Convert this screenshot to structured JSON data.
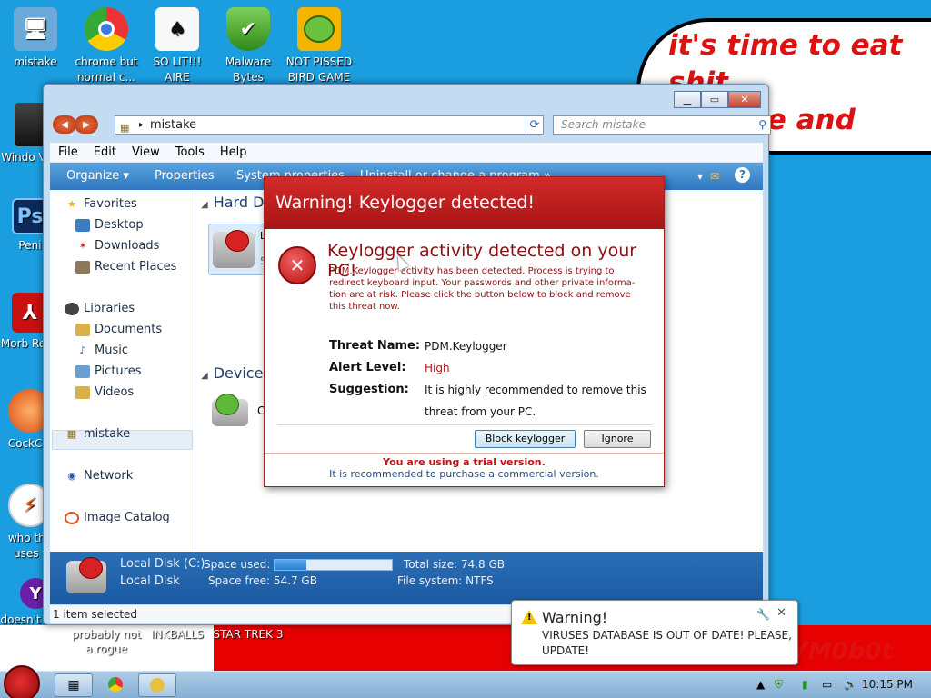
{
  "desktop": {
    "icons": [
      {
        "label": "mistake",
        "icon": "computer-icon"
      },
      {
        "label": "chrome but normal c...",
        "icon": "chrome-icon"
      },
      {
        "label": "SO LIT!!! AIRE",
        "icon": "solitaire-icon"
      },
      {
        "label": "Malware Bytes",
        "icon": "shield-icon"
      },
      {
        "label": "NOT PISSED BIRD GAME",
        "icon": "bird-game-icon"
      },
      {
        "label": "Windo Vist",
        "icon": "trash-icon"
      },
      {
        "label": "Peni",
        "icon": "photoshop-icon"
      },
      {
        "label": "Morb Read",
        "icon": "pdf-icon"
      },
      {
        "label": "CockCle",
        "icon": "cleaner-icon"
      },
      {
        "label": "who the uses t",
        "icon": "lightning-icon"
      },
      {
        "label": "doesn't work lol",
        "icon": "yahoo-icon"
      }
    ],
    "bubble_text": "it's time to eat shit\nand die and chew\n       gum",
    "strip_labels": [
      "probably not a rogue",
      "INKBALLS",
      "STAR TREK 3"
    ],
    "signature": "YM0b0t"
  },
  "explorer": {
    "address": "mistake",
    "search_placeholder": "Search mistake",
    "menu": [
      "File",
      "Edit",
      "View",
      "Tools",
      "Help"
    ],
    "commands": {
      "organize": "Organize ▾",
      "properties": "Properties",
      "system_properties": "System properties",
      "uninstall": "Uninstall or change a program",
      "more": "»"
    },
    "nav": {
      "favorites": "Favorites",
      "desktop": "Desktop",
      "downloads": "Downloads",
      "recent": "Recent Places",
      "libraries": "Libraries",
      "documents": "Documents",
      "music": "Music",
      "pictures": "Pictures",
      "videos": "Videos",
      "computer": "mistake",
      "network": "Network",
      "image_catalog": "Image Catalog"
    },
    "sections": {
      "hard_disk": "Hard Di",
      "devices": "Devices",
      "drive_label_frag": "L",
      "drive_size_frag": "5",
      "device_frag": "C"
    },
    "details": {
      "drive_name": "Local Disk (C:)",
      "drive_type": "Local Disk",
      "space_used_label": "Space used:",
      "space_free": "Space free: 54.7 GB",
      "total_size": "Total size: 74.8 GB",
      "file_system": "File system: NTFS",
      "used_fraction": 0.27
    },
    "status": "1 item selected"
  },
  "dialog": {
    "header": "Warning! Keylogger detected!",
    "title": "Keylogger activity detected on your PC!",
    "description": "PDM.Keylogger activity has been detected. Process is trying to redirect keyboard input. Your passwords and other private informa-tion are at risk. Please click the button below to block and remove this threat now.",
    "threat_name_label": "Threat Name:",
    "threat_name": "PDM.Keylogger",
    "alert_level_label": "Alert Level:",
    "alert_level": "High",
    "suggestion_label": "Suggestion:",
    "suggestion_line1": "It is highly recommended to remove this",
    "suggestion_line2": "threat from your PC.",
    "block_button": "Block keylogger",
    "ignore_button": "Ignore",
    "trial_line1": "You are using a trial version.",
    "trial_line2": "It is recommended to purchase a commercial version."
  },
  "toast": {
    "title": "Warning!",
    "message": "VIRUSES DATABASE IS OUT OF DATE! PLEASE, UPDATE!"
  },
  "taskbar": {
    "clock": "10:15 PM"
  },
  "colors": {
    "desktop_bg": "#1a9ee0",
    "dialog_header": "#c01f1f",
    "alert_text": "#b81414"
  }
}
